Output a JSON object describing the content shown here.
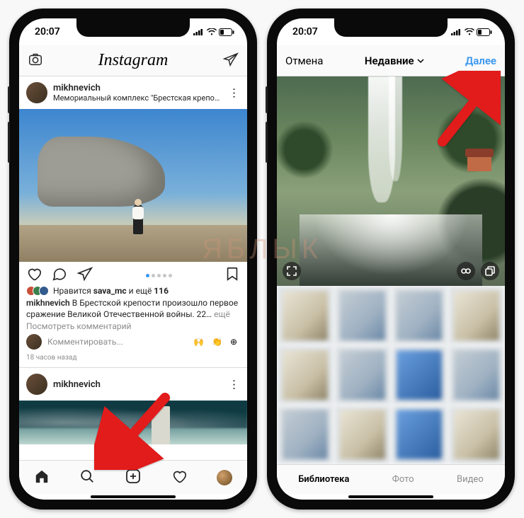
{
  "status": {
    "time": "20:07"
  },
  "left": {
    "header": {
      "logo": "Instagram"
    },
    "post1": {
      "username": "mikhnevich",
      "location": "Мемориальный комплекс \"Брестская крепость-ге…",
      "likes_prefix": "Нравится",
      "likes_name": "sava_mc",
      "likes_and": "и ещё",
      "likes_count": "116",
      "caption_user": "mikhnevich",
      "caption_text": "В Брестской крепости произошло первое сражение Великой Отечественной войны. 22…",
      "caption_more": "ещё",
      "view_comments": "Посмотреть комментарий",
      "comment_placeholder": "Комментировать...",
      "emojis": "🙌 👏 ⊕",
      "timestamp": "18 часов назад"
    },
    "post2": {
      "username": "mikhnevich"
    },
    "tabs": {
      "home": "home",
      "search": "search",
      "add": "add",
      "activity": "activity",
      "profile": "profile"
    }
  },
  "right": {
    "cancel": "Отмена",
    "album": "Недавние",
    "next": "Далее",
    "picker_tabs": {
      "library": "Библиотека",
      "photo": "Фото",
      "video": "Видео"
    }
  },
  "watermark": "ЯБЛЫК"
}
